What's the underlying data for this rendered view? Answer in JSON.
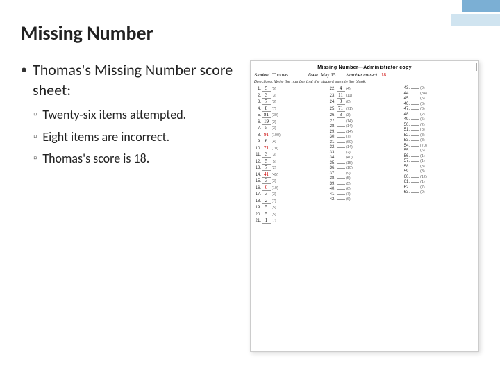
{
  "page": {
    "title": "Missing Number",
    "background": "#ffffff"
  },
  "left": {
    "main_bullet": "Thomas's Missing Number score sheet:",
    "sub_bullets": [
      "Twenty-six items attempted.",
      "Eight items are incorrect.",
      "Thomas's score is 18."
    ]
  },
  "score_sheet": {
    "title": "Missing Number—Administrator copy",
    "student_label": "Student",
    "student_name": "Thomas",
    "date_label": "Date",
    "date_value": "May 15",
    "number_correct_label": "Number correct:",
    "number_correct_value": "18",
    "directions": "Directions: Write the number that the student says in the blank.",
    "columns": [
      {
        "items": [
          {
            "num": "1.",
            "answer": "5",
            "possible": "(5)",
            "incorrect": false
          },
          {
            "num": "2.",
            "answer": "3",
            "possible": "(3)",
            "incorrect": false
          },
          {
            "num": "3.",
            "answer": "7",
            "possible": "(3)",
            "incorrect": false
          },
          {
            "num": "4.",
            "answer": "8",
            "possible": "(7)",
            "incorrect": false
          },
          {
            "num": "5.",
            "answer": "81",
            "possible": "(30)",
            "incorrect": false
          },
          {
            "num": "6.",
            "answer": "19",
            "possible": "(2)",
            "incorrect": false
          },
          {
            "num": "7.",
            "answer": "5",
            "possible": "(3)",
            "incorrect": false
          },
          {
            "num": "8.",
            "answer": "91",
            "possible": "(100)",
            "incorrect": true
          },
          {
            "num": "9.",
            "answer": "6",
            "possible": "(4)",
            "incorrect": false
          },
          {
            "num": "10.",
            "answer": "71",
            "possible": "(70)",
            "incorrect": true
          },
          {
            "num": "11.",
            "answer": "3",
            "possible": "(3)",
            "incorrect": false
          },
          {
            "num": "12.",
            "answer": "5",
            "possible": "(5)",
            "incorrect": false
          },
          {
            "num": "13.",
            "answer": "7",
            "possible": "(2)",
            "incorrect": false
          },
          {
            "num": "14.",
            "answer": "41",
            "possible": "(45)",
            "incorrect": true
          },
          {
            "num": "15.",
            "answer": "3",
            "possible": "(3)",
            "incorrect": false
          },
          {
            "num": "16.",
            "answer": "0",
            "possible": "(10)",
            "incorrect": true
          },
          {
            "num": "17.",
            "answer": "3",
            "possible": "(3)",
            "incorrect": false
          },
          {
            "num": "18.",
            "answer": "2",
            "possible": "(7)",
            "incorrect": false
          },
          {
            "num": "19.",
            "answer": "5",
            "possible": "(5)",
            "incorrect": false
          },
          {
            "num": "20.",
            "answer": "5",
            "possible": "(5)",
            "incorrect": false
          },
          {
            "num": "21.",
            "answer": "1",
            "possible": "(7)",
            "incorrect": false
          }
        ]
      },
      {
        "items": [
          {
            "num": "22.",
            "answer": "4",
            "possible": "(4)",
            "incorrect": false
          },
          {
            "num": "23.",
            "answer": "11",
            "possible": "(11)",
            "incorrect": false
          },
          {
            "num": "24.",
            "answer": "0",
            "possible": "(0)",
            "incorrect": false
          },
          {
            "num": "25.",
            "answer": "71",
            "possible": "(71)",
            "incorrect": false
          },
          {
            "num": "26.",
            "answer": "3",
            "possible": "(3)",
            "incorrect": false
          },
          {
            "num": "27.",
            "answer": "",
            "possible": "(14)",
            "incorrect": false
          },
          {
            "num": "28.",
            "answer": "",
            "possible": "(14)",
            "incorrect": false
          },
          {
            "num": "29.",
            "answer": "",
            "possible": "(14)",
            "incorrect": false
          },
          {
            "num": "30.",
            "answer": "",
            "possible": "(7)",
            "incorrect": false
          },
          {
            "num": "31.",
            "answer": "",
            "possible": "(60)",
            "incorrect": false
          },
          {
            "num": "32.",
            "answer": "",
            "possible": "(14)",
            "incorrect": false
          },
          {
            "num": "33.",
            "answer": "",
            "possible": "(2)",
            "incorrect": false
          },
          {
            "num": "34.",
            "answer": "",
            "possible": "(40)",
            "incorrect": false
          },
          {
            "num": "35.",
            "answer": "",
            "possible": "(15)",
            "incorrect": false
          },
          {
            "num": "36.",
            "answer": "",
            "possible": "(10)",
            "incorrect": false
          },
          {
            "num": "37.",
            "answer": "",
            "possible": "(9)",
            "incorrect": false
          },
          {
            "num": "38.",
            "answer": "",
            "possible": "(5)",
            "incorrect": false
          },
          {
            "num": "39.",
            "answer": "",
            "possible": "(5)",
            "incorrect": false
          },
          {
            "num": "40.",
            "answer": "",
            "possible": "(6)",
            "incorrect": false
          },
          {
            "num": "41.",
            "answer": "",
            "possible": "(7)",
            "incorrect": false
          },
          {
            "num": "42.",
            "answer": "",
            "possible": "(6)",
            "incorrect": false
          }
        ]
      },
      {
        "items": [
          {
            "num": "43.",
            "answer": "",
            "possible": "(9)",
            "incorrect": false
          },
          {
            "num": "44.",
            "answer": "",
            "possible": "(84)",
            "incorrect": false
          },
          {
            "num": "45.",
            "answer": "",
            "possible": "(5)",
            "incorrect": false
          },
          {
            "num": "46.",
            "answer": "",
            "possible": "(6)",
            "incorrect": false
          },
          {
            "num": "47.",
            "answer": "",
            "possible": "(6)",
            "incorrect": false
          },
          {
            "num": "48.",
            "answer": "",
            "possible": "(2)",
            "incorrect": false
          },
          {
            "num": "49.",
            "answer": "",
            "possible": "(5)",
            "incorrect": false
          },
          {
            "num": "50.",
            "answer": "",
            "possible": "(2)",
            "incorrect": false
          },
          {
            "num": "51.",
            "answer": "",
            "possible": "(8)",
            "incorrect": false
          },
          {
            "num": "52.",
            "answer": "",
            "possible": "(8)",
            "incorrect": false
          },
          {
            "num": "53.",
            "answer": "",
            "possible": "(8)",
            "incorrect": false
          },
          {
            "num": "54.",
            "answer": "",
            "possible": "(70)",
            "incorrect": false
          },
          {
            "num": "55.",
            "answer": "",
            "possible": "(6)",
            "incorrect": false
          },
          {
            "num": "56.",
            "answer": "",
            "possible": "(1)",
            "incorrect": false
          },
          {
            "num": "57.",
            "answer": "",
            "possible": "(1)",
            "incorrect": false
          },
          {
            "num": "58.",
            "answer": "",
            "possible": "(3)",
            "incorrect": false
          },
          {
            "num": "59.",
            "answer": "",
            "possible": "(3)",
            "incorrect": false
          },
          {
            "num": "60.",
            "answer": "",
            "possible": "(12)",
            "incorrect": false
          },
          {
            "num": "61.",
            "answer": "",
            "possible": "(1)",
            "incorrect": false
          },
          {
            "num": "62.",
            "answer": "",
            "possible": "(7)",
            "incorrect": false
          },
          {
            "num": "63.",
            "answer": "",
            "possible": "(9)",
            "incorrect": false
          }
        ]
      }
    ]
  }
}
